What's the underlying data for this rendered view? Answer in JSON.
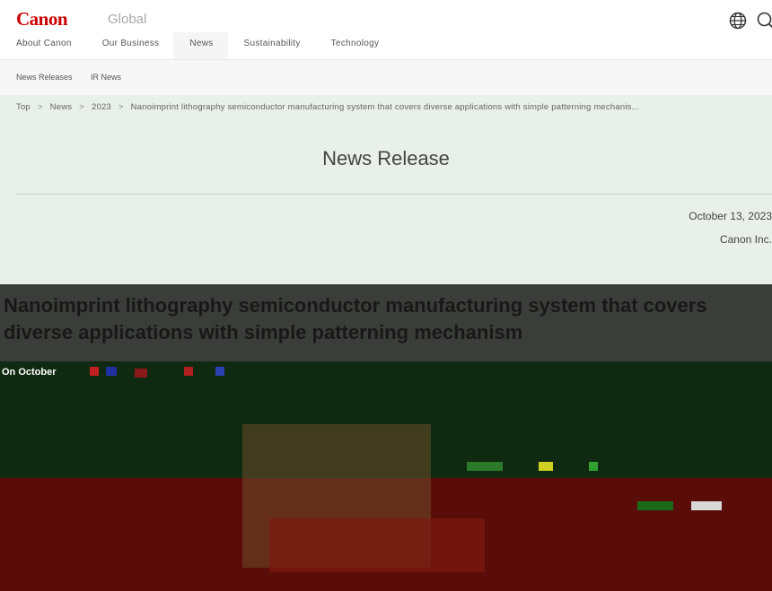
{
  "header": {
    "logo": "Canon",
    "site": "Global",
    "globe_icon": "globe-icon",
    "search_icon": "search-icon"
  },
  "main_nav": [
    {
      "label": "About Canon",
      "active": false
    },
    {
      "label": "Our Business",
      "active": false
    },
    {
      "label": "News",
      "active": true
    },
    {
      "label": "Sustainability",
      "active": false
    },
    {
      "label": "Technology",
      "active": false
    }
  ],
  "sub_nav": {
    "items": [
      "News Releases",
      "IR News"
    ]
  },
  "breadcrumb": {
    "items": [
      "Top",
      "News",
      "2023",
      "Nanoimprint lithography semiconductor manufacturing system that covers diverse applications with simple patterning mechanis..."
    ],
    "separator": ">"
  },
  "release": {
    "title": "News Release",
    "date": "October 13, 2023",
    "organization": "Canon Inc."
  },
  "article": {
    "headline": "Nanoimprint lithography semiconductor manufacturing system that covers diverse applications with simple patterning mechanism",
    "caption": "On October"
  },
  "colors": {
    "brand": "#cc0000",
    "panel": "#e9efe9",
    "banner": "#3b3d3a"
  }
}
